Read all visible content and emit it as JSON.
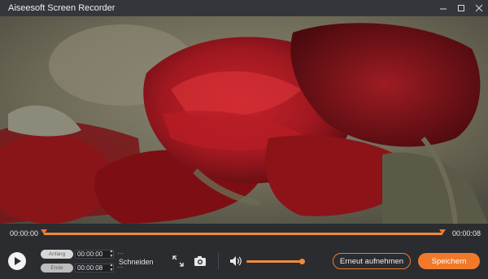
{
  "window": {
    "title": "Aiseesoft Screen Recorder"
  },
  "icons": {
    "minimize": "minimize-icon",
    "maximize": "maximize-icon",
    "close": "close-icon",
    "play": "play-icon",
    "fullscreen": "fullscreen-icon",
    "snapshot": "camera-icon",
    "volume": "speaker-icon"
  },
  "timeline": {
    "current": "00:00:00",
    "total": "00:00:08"
  },
  "trim": {
    "start_label": "Anfang",
    "start_value": "00:00:00",
    "end_label": "Ende",
    "end_value": "00:00:08",
    "more": "···",
    "cut_label": "Schneiden"
  },
  "volume": {
    "level": 0.92
  },
  "buttons": {
    "rerecord": "Erneut aufnehmen",
    "save": "Speichern"
  },
  "colors": {
    "accent": "#f07a2a",
    "background": "#2b2c30"
  }
}
